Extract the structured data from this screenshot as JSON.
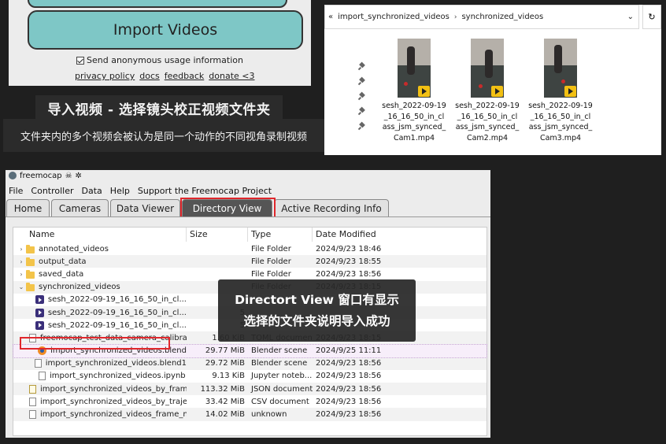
{
  "import_panel": {
    "button_label": "Import Videos",
    "checkbox_label": "Send anonymous usage information",
    "checkbox_checked": true,
    "links": [
      "privacy policy",
      "docs",
      "feedback",
      "donate <3"
    ]
  },
  "captions": {
    "title": "导入视频 - 选择镜头校正视频文件夹",
    "subtitle": "文件夹内的多个视频会被认为是同一个动作的不同视角录制视频",
    "overlay_line1": "Directort View 窗口有显示",
    "overlay_line2": "选择的文件夹说明导入成功"
  },
  "explorer": {
    "breadcrumb": [
      "import_synchronized_videos",
      "synchronized_videos"
    ],
    "breadcrumb_prefix": "«",
    "files": [
      {
        "name": "sesh_2022-09-19_16_16_50_in_class_jsm_synced_Cam1.mp4",
        "icon": "video-thumbnail"
      },
      {
        "name": "sesh_2022-09-19_16_16_50_in_class_jsm_synced_Cam2.mp4",
        "icon": "video-thumbnail"
      },
      {
        "name": "sesh_2022-09-19_16_16_50_in_class_jsm_synced_Cam3.mp4",
        "icon": "video-thumbnail"
      }
    ]
  },
  "freemocap": {
    "window_title": "freemocap",
    "menu": [
      "File",
      "Controller",
      "Data",
      "Help",
      "Support the Freemocap Project"
    ],
    "tabs": [
      "Home",
      "Cameras",
      "Data Viewer",
      "Directory View",
      "Active Recording Info"
    ],
    "active_tab": "Directory View",
    "columns": [
      "Name",
      "Size",
      "Type",
      "Date Modified"
    ],
    "rows": [
      {
        "arrow": ">",
        "icon": "folder",
        "name": "annotated_videos",
        "size": "",
        "type": "File Folder",
        "date": "2024/9/23 18:46"
      },
      {
        "arrow": ">",
        "icon": "folder",
        "name": "output_data",
        "size": "",
        "type": "File Folder",
        "date": "2024/9/23 18:55"
      },
      {
        "arrow": ">",
        "icon": "folder",
        "name": "saved_data",
        "size": "",
        "type": "File Folder",
        "date": "2024/9/23 18:56"
      },
      {
        "arrow": "v",
        "icon": "folder",
        "name": "synchronized_videos",
        "size": "",
        "type": "File Folder",
        "date": "2024/9/23 18:15"
      },
      {
        "arrow": "",
        "icon": "video",
        "name": "sesh_2022-09-19_16_16_50_in_cl...",
        "size": "5",
        "type": "",
        "date": ""
      },
      {
        "arrow": "",
        "icon": "video",
        "name": "sesh_2022-09-19_16_16_50_in_cl...",
        "size": "5",
        "type": "",
        "date": ""
      },
      {
        "arrow": "",
        "icon": "video",
        "name": "sesh_2022-09-19_16_16_50_in_cl...",
        "size": "5",
        "type": "",
        "date": ""
      },
      {
        "arrow": "",
        "icon": "doc",
        "name": "freemocap_test_data_camera_calibrati...",
        "size": "1.60 KiB",
        "type": "TOML document",
        "date": "2024/9/23 18:15"
      },
      {
        "arrow": "",
        "icon": "blend",
        "name": "import_synchronized_videos.blend",
        "size": "29.77 MiB",
        "type": "Blender scene",
        "date": "2024/9/25 11:11"
      },
      {
        "arrow": "",
        "icon": "doc",
        "name": "import_synchronized_videos.blend1",
        "size": "29.72 MiB",
        "type": "Blender scene",
        "date": "2024/9/23 18:56"
      },
      {
        "arrow": "",
        "icon": "doc",
        "name": "import_synchronized_videos.ipynb",
        "size": "9.13 KiB",
        "type": "Jupyter noteb...",
        "date": "2024/9/23 18:56"
      },
      {
        "arrow": "",
        "icon": "json",
        "name": "import_synchronized_videos_by_frame...",
        "size": "113.32 MiB",
        "type": "JSON document",
        "date": "2024/9/23 18:56"
      },
      {
        "arrow": "",
        "icon": "doc",
        "name": "import_synchronized_videos_by_trajec...",
        "size": "33.42 MiB",
        "type": "CSV document",
        "date": "2024/9/23 18:56"
      },
      {
        "arrow": "",
        "icon": "doc",
        "name": "import_synchronized_videos_frame_na...",
        "size": "14.02 MiB",
        "type": "unknown",
        "date": "2024/9/23 18:56"
      }
    ]
  },
  "colors": {
    "accent_button": "#7ec7c6",
    "highlight_red": "#e0272c",
    "background": "#1f1f1f"
  }
}
